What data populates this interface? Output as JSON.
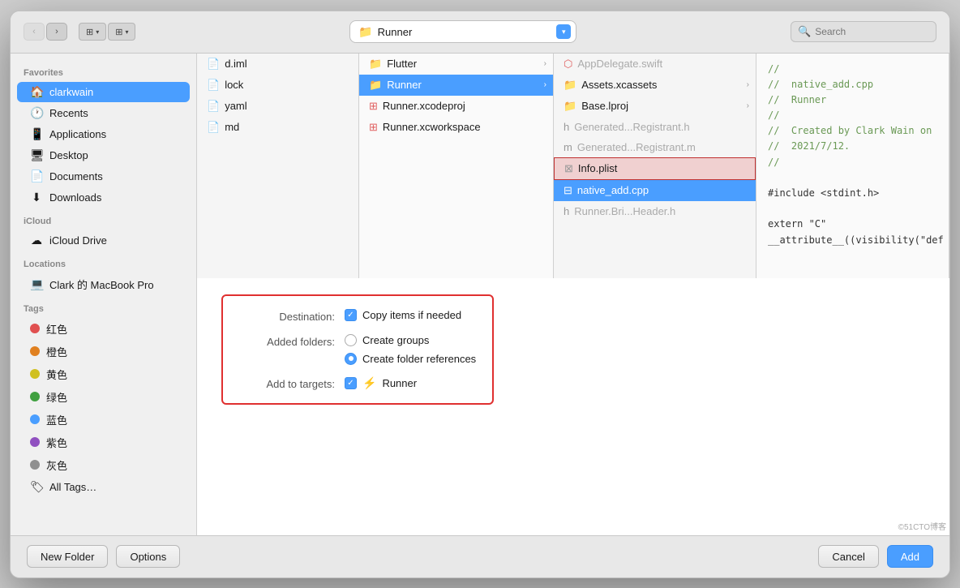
{
  "toolbar": {
    "path_label": "Runner",
    "search_placeholder": "Search"
  },
  "sidebar": {
    "favorites_label": "Favorites",
    "icloud_label": "iCloud",
    "locations_label": "Locations",
    "tags_label": "Tags",
    "items": [
      {
        "id": "clarkwain",
        "label": "clarkwain",
        "icon": "🏠",
        "active": true
      },
      {
        "id": "recents",
        "label": "Recents",
        "icon": "🕐"
      },
      {
        "id": "applications",
        "label": "Applications",
        "icon": "📱"
      },
      {
        "id": "desktop",
        "label": "Desktop",
        "icon": "🖥"
      },
      {
        "id": "documents",
        "label": "Documents",
        "icon": "📄"
      },
      {
        "id": "downloads",
        "label": "Downloads",
        "icon": "⬇"
      }
    ],
    "icloud_items": [
      {
        "id": "icloud-drive",
        "label": "iCloud Drive",
        "icon": "☁"
      }
    ],
    "location_items": [
      {
        "id": "macbook",
        "label": "Clark 的 MacBook Pro",
        "icon": "💻"
      }
    ],
    "tags": [
      {
        "id": "red",
        "label": "红色",
        "color": "#e05050"
      },
      {
        "id": "orange",
        "label": "橙色",
        "color": "#e08020"
      },
      {
        "id": "yellow",
        "label": "黄色",
        "color": "#d0c020"
      },
      {
        "id": "green",
        "label": "绿色",
        "color": "#40a040"
      },
      {
        "id": "blue",
        "label": "蓝色",
        "color": "#4a9eff"
      },
      {
        "id": "purple",
        "label": "紫色",
        "color": "#9050c0"
      },
      {
        "id": "gray",
        "label": "灰色",
        "color": "#909090"
      },
      {
        "id": "all-tags",
        "label": "All Tags…",
        "icon": "🏷"
      }
    ]
  },
  "col1": {
    "items": [
      {
        "label": "d.iml",
        "type": "file"
      },
      {
        "label": "lock",
        "type": "file"
      },
      {
        "label": "yaml",
        "type": "file"
      },
      {
        "label": "md",
        "type": "file"
      }
    ]
  },
  "col2": {
    "items": [
      {
        "label": "Flutter",
        "type": "folder",
        "has_chevron": true
      },
      {
        "label": "Runner",
        "type": "folder",
        "has_chevron": true,
        "selected": true
      },
      {
        "label": "Runner.xcodeproj",
        "type": "file"
      },
      {
        "label": "Runner.xcworkspace",
        "type": "file"
      }
    ]
  },
  "col3": {
    "items": [
      {
        "label": "AppDelegate.swift",
        "type": "swift",
        "dimmed": true
      },
      {
        "label": "Assets.xcassets",
        "type": "folder",
        "has_chevron": true
      },
      {
        "label": "Base.lproj",
        "type": "folder",
        "has_chevron": true
      },
      {
        "label": "Generated...Registrant.h",
        "type": "header",
        "dimmed": true
      },
      {
        "label": "Generated...Registrant.m",
        "type": "source",
        "dimmed": true
      },
      {
        "label": "Info.plist",
        "type": "plist",
        "dimmed": true,
        "highlighted": true
      },
      {
        "label": "native_add.cpp",
        "type": "cpp",
        "selected": true
      },
      {
        "label": "Runner.Bri...Header.h",
        "type": "header",
        "dimmed": true
      }
    ]
  },
  "code_preview": {
    "lines": [
      {
        "text": "//",
        "type": "comment"
      },
      {
        "text": "//  native_add.cpp",
        "type": "comment"
      },
      {
        "text": "//  Runner",
        "type": "comment"
      },
      {
        "text": "//",
        "type": "comment"
      },
      {
        "text": "//  Created by Clark Wain on",
        "type": "comment"
      },
      {
        "text": "//  2021/7/12.",
        "type": "comment"
      },
      {
        "text": "//",
        "type": "comment"
      },
      {
        "text": "",
        "type": "normal"
      },
      {
        "text": "#include <stdint.h>",
        "type": "normal"
      },
      {
        "text": "",
        "type": "normal"
      },
      {
        "text": "extern \"C\"",
        "type": "normal"
      },
      {
        "text": "__attribute__((visibility(\"def",
        "type": "normal"
      }
    ]
  },
  "overlay": {
    "destination_label": "Destination:",
    "added_folders_label": "Added folders:",
    "add_to_targets_label": "Add to targets:",
    "copy_items_label": "Copy items if needed",
    "create_groups_label": "Create groups",
    "create_folder_refs_label": "Create folder references",
    "runner_label": "Runner"
  },
  "bottom_bar": {
    "new_folder_label": "New Folder",
    "options_label": "Options",
    "cancel_label": "Cancel",
    "add_label": "Add"
  },
  "nav_buttons": {
    "back_label": "‹",
    "forward_label": "›"
  }
}
